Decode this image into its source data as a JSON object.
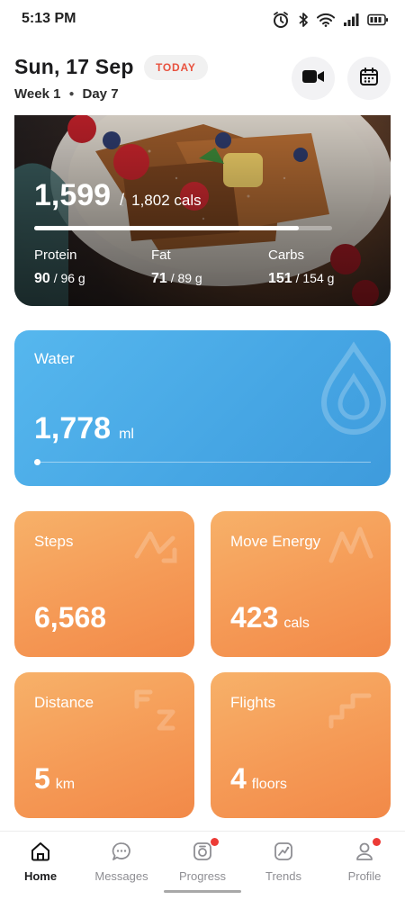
{
  "status_bar": {
    "time": "5:13 PM",
    "icons": [
      "alarm-icon",
      "bluetooth-icon",
      "wifi-icon",
      "signal-icon",
      "battery-icon"
    ]
  },
  "header": {
    "date": "Sun, 17 Sep",
    "badge": "TODAY",
    "week_label": "Week",
    "week_num": "1",
    "day_label": "Day",
    "day_num": "7",
    "actions": [
      "video-icon",
      "calendar-icon"
    ]
  },
  "calories": {
    "consumed": "1,599",
    "separator": "/",
    "total": "1,802 cals",
    "progress": 0.887,
    "macros": [
      {
        "label": "Protein",
        "value": "90",
        "total": "/ 96 g"
      },
      {
        "label": "Fat",
        "value": "71",
        "total": "/ 89 g"
      },
      {
        "label": "Carbs",
        "value": "151",
        "total": "/ 154 g"
      }
    ]
  },
  "water": {
    "label": "Water",
    "value": "1,778",
    "unit": "ml",
    "progress": 0.0
  },
  "activity": {
    "steps": {
      "label": "Steps",
      "value": "6,568",
      "unit": ""
    },
    "move_energy": {
      "label": "Move Energy",
      "value": "423",
      "unit": "cals"
    },
    "distance": {
      "label": "Distance",
      "value": "5",
      "unit": "km"
    },
    "flights": {
      "label": "Flights",
      "value": "4",
      "unit": "floors"
    }
  },
  "nav": {
    "items": [
      {
        "label": "Home",
        "icon": "home-icon",
        "active": true,
        "badge": false
      },
      {
        "label": "Messages",
        "icon": "chat-icon",
        "active": false,
        "badge": false
      },
      {
        "label": "Progress",
        "icon": "camera-icon",
        "active": false,
        "badge": true
      },
      {
        "label": "Trends",
        "icon": "trend-chart-icon",
        "active": false,
        "badge": false
      },
      {
        "label": "Profile",
        "icon": "user-icon",
        "active": false,
        "badge": true
      }
    ]
  },
  "colors": {
    "accent_red": "#e8523f",
    "water_blue": "#4aa9e6",
    "activity_orange": "#f59a56"
  }
}
